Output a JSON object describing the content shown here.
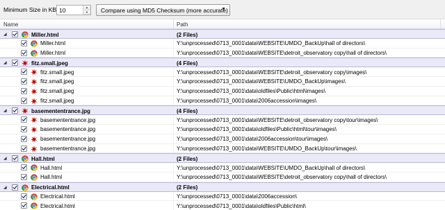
{
  "toolbar": {
    "min_size_label": "Minimum Size in KB:",
    "min_size_value": "10",
    "compare_mode": "Compare using MD5 Checksum (more accurate)"
  },
  "columns": {
    "name": "Name",
    "path": "Path"
  },
  "colors": {
    "group_row_bg": "#e9e9f8",
    "group_row_border": "#b7b7de"
  },
  "groups": [
    {
      "name": "Miller.html",
      "count": "(2 Files)",
      "icon": "chrome-html-icon",
      "checked": true,
      "expanded": true,
      "files": [
        {
          "name": "Miller.html",
          "path": "Y:\\unprocessed\\0713_0001\\data\\WEBSITE\\UMDO_BackUp\\hall of directors\\",
          "checked": true
        },
        {
          "name": "Miller.html",
          "path": "Y:\\unprocessed\\0713_0001\\data\\WEBSITE\\detroit_observatory copy\\hall of directors\\",
          "checked": true
        }
      ]
    },
    {
      "name": "fitz.small.jpeg",
      "count": "(4 Files)",
      "icon": "image-file-icon",
      "checked": true,
      "expanded": true,
      "files": [
        {
          "name": "fitz.small.jpeg",
          "path": "Y:\\unprocessed\\0713_0001\\data\\WEBSITE\\detroit_observatory copy\\images\\",
          "checked": true
        },
        {
          "name": "fitz.small.jpeg",
          "path": "Y:\\unprocessed\\0713_0001\\data\\WEBSITE\\UMDO_BackUp\\images\\",
          "checked": true
        },
        {
          "name": "fitz.small.jpeg",
          "path": "Y:\\unprocessed\\0713_0001\\data\\oldfiles\\Public\\html\\images\\",
          "checked": true
        },
        {
          "name": "fitz.small.jpeg",
          "path": "Y:\\unprocessed\\0713_0001\\data\\2006accession\\images\\",
          "checked": true
        }
      ]
    },
    {
      "name": "basemententrance.jpg",
      "count": "(4 Files)",
      "icon": "image-file-icon",
      "checked": true,
      "expanded": true,
      "files": [
        {
          "name": "basemententrance.jpg",
          "path": "Y:\\unprocessed\\0713_0001\\data\\WEBSITE\\detroit_observatory copy\\tour\\images\\",
          "checked": true
        },
        {
          "name": "basemententrance.jpg",
          "path": "Y:\\unprocessed\\0713_0001\\data\\oldfiles\\Public\\html\\tour\\images\\",
          "checked": true
        },
        {
          "name": "basemententrance.jpg",
          "path": "Y:\\unprocessed\\0713_0001\\data\\2006accession\\tour\\images\\",
          "checked": true
        },
        {
          "name": "basemententrance.jpg",
          "path": "Y:\\unprocessed\\0713_0001\\data\\WEBSITE\\UMDO_BackUp\\tour\\images\\",
          "checked": true
        }
      ]
    },
    {
      "name": "Hall.html",
      "count": "(2 Files)",
      "icon": "chrome-html-icon",
      "checked": true,
      "expanded": true,
      "files": [
        {
          "name": "Hall.html",
          "path": "Y:\\unprocessed\\0713_0001\\data\\WEBSITE\\UMDO_BackUp\\hall of directors\\",
          "checked": true
        },
        {
          "name": "Hall.html",
          "path": "Y:\\unprocessed\\0713_0001\\data\\WEBSITE\\detroit_observatory copy\\hall of directors\\",
          "checked": true
        }
      ]
    },
    {
      "name": "Electrical.html",
      "count": "(2 Files)",
      "icon": "chrome-html-icon",
      "checked": true,
      "expanded": true,
      "files": [
        {
          "name": "Electrical.html",
          "path": "Y:\\unprocessed\\0713_0001\\data\\2006accession\\",
          "checked": true
        },
        {
          "name": "Electrical.html",
          "path": "Y:\\unprocessed\\0713_0001\\data\\oldfiles\\Public\\html\\",
          "checked": true
        }
      ]
    }
  ]
}
